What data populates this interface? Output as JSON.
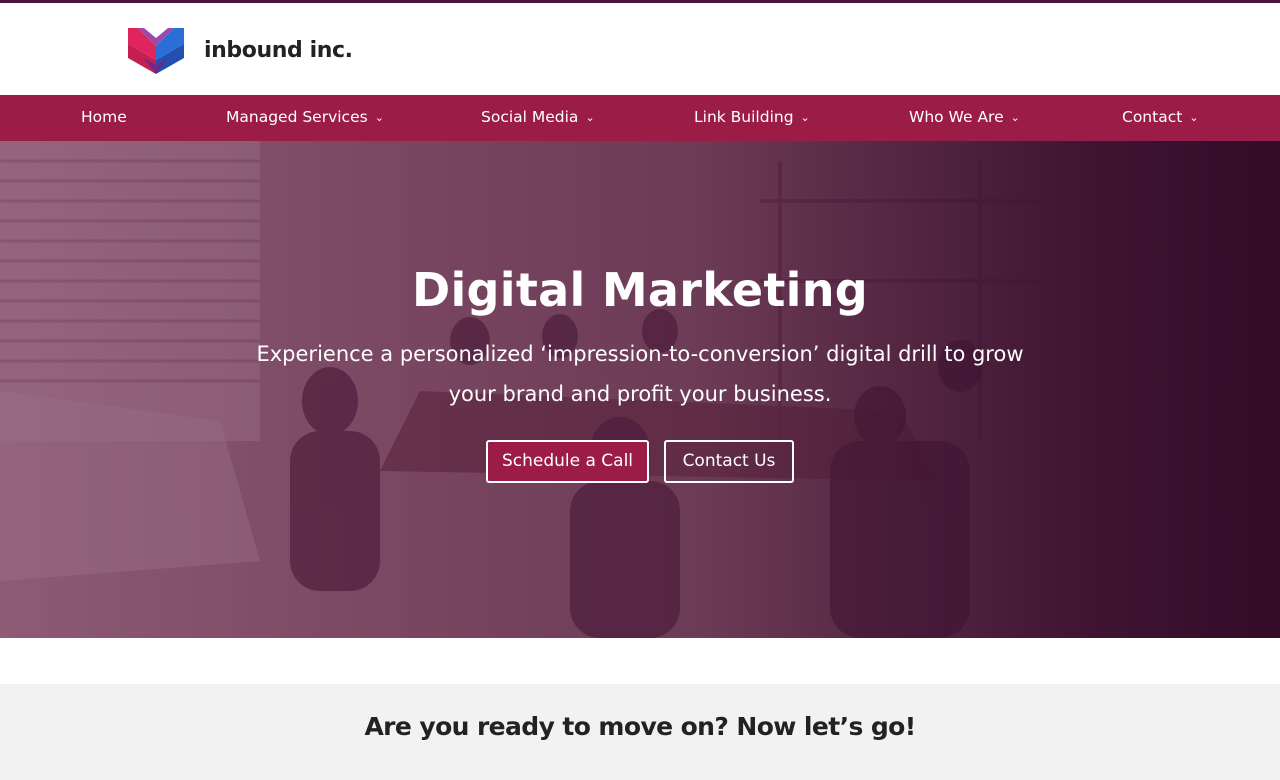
{
  "brand": {
    "name": "inbound inc.",
    "logo_icon": "inbound-logo-mark",
    "colors": {
      "primary": "#9b1c47",
      "dark": "#4a1442",
      "logo_red": "#e0245e",
      "logo_blue": "#2b6fd6",
      "logo_purple": "#6a2a8c"
    }
  },
  "nav": {
    "items": [
      {
        "label": "Home",
        "has_dropdown": false
      },
      {
        "label": "Managed Services",
        "has_dropdown": true
      },
      {
        "label": "Social Media",
        "has_dropdown": true
      },
      {
        "label": "Link Building",
        "has_dropdown": true
      },
      {
        "label": "Who We Are",
        "has_dropdown": true
      },
      {
        "label": "Contact",
        "has_dropdown": true
      }
    ],
    "dropdown_icon": "⌄"
  },
  "hero": {
    "title": "Digital Marketing",
    "subtitle": "Experience a personalized ‘impression-to-conversion’ digital drill to grow your brand and profit your business.",
    "primary_button": "Schedule a Call",
    "secondary_button": "Contact Us",
    "background": "team meeting at a long table in a loft office"
  },
  "section": {
    "heading_light": "Are you ready to move on?",
    "heading_bold": "Now let’s go!"
  }
}
